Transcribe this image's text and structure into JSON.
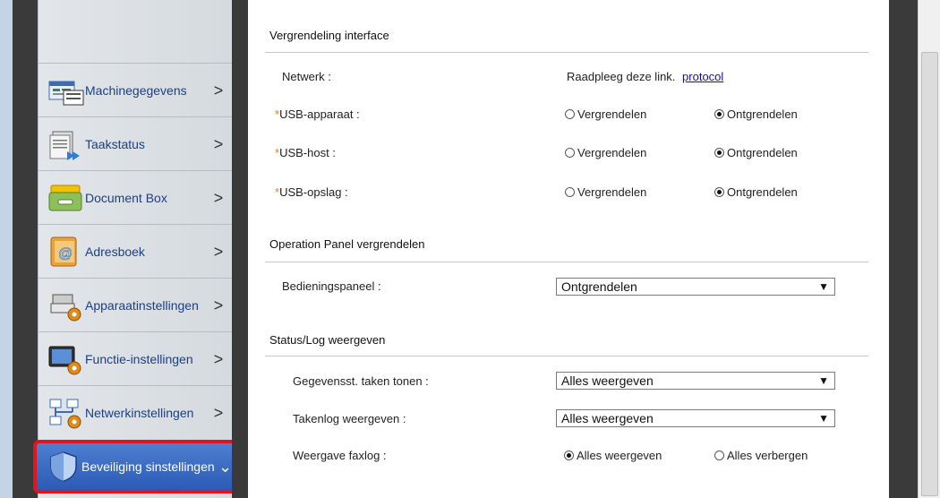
{
  "sidebar": {
    "items": [
      {
        "label": "Machinegegevens"
      },
      {
        "label": "Taakstatus"
      },
      {
        "label": "Document Box"
      },
      {
        "label": "Adresboek"
      },
      {
        "label": "Apparaatinstellingen"
      },
      {
        "label": "Functie-instellingen"
      },
      {
        "label": "Netwerkinstellingen"
      },
      {
        "label": "Beveiliging sinstellingen"
      }
    ],
    "chevron": ">",
    "active_chevron": "⌄"
  },
  "interface_lock": {
    "title": "Vergrendeling interface",
    "network": {
      "label": "Netwerk :",
      "text": "Raadpleeg deze link.",
      "link": "protocol"
    },
    "rows": [
      {
        "required": "*",
        "label": "USB-apparaat :",
        "opt1": "Vergrendelen",
        "opt2": "Ontgrendelen",
        "selected": "Ontgrendelen"
      },
      {
        "required": "*",
        "label": "USB-host :",
        "opt1": "Vergrendelen",
        "opt2": "Ontgrendelen",
        "selected": "Ontgrendelen"
      },
      {
        "required": "*",
        "label": "USB-opslag :",
        "opt1": "Vergrendelen",
        "opt2": "Ontgrendelen",
        "selected": "Ontgrendelen"
      }
    ]
  },
  "panel_lock": {
    "title": "Operation Panel vergrendelen",
    "label": "Bedieningspaneel :",
    "value": "Ontgrendelen"
  },
  "status_log": {
    "title": "Status/Log weergeven",
    "job_details": {
      "label": "Gegevensst. taken tonen :",
      "value": "Alles weergeven"
    },
    "job_log": {
      "label": "Takenlog weergeven :",
      "value": "Alles weergeven"
    },
    "fax_log": {
      "label": "Weergave faxlog :",
      "opt1": "Alles weergeven",
      "opt2": "Alles verbergen",
      "selected": "Alles weergeven"
    }
  },
  "dropdown_arrow": "▼"
}
